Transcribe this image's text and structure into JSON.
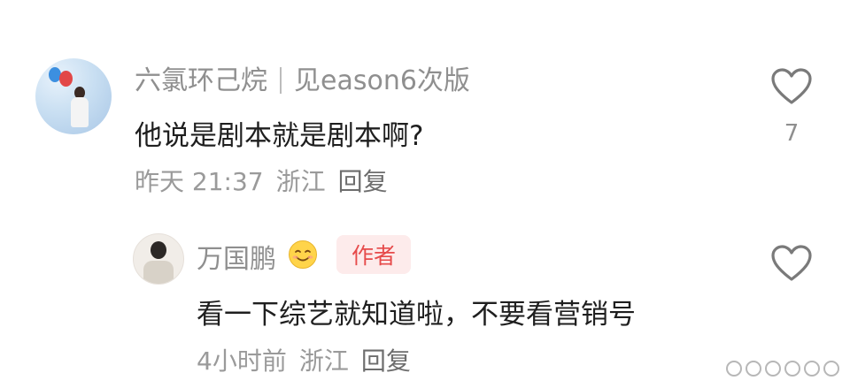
{
  "comment": {
    "username": "六氯环己烷",
    "user_tag": "见eason6次版",
    "text": "他说是剧本就是剧本啊?",
    "time": "昨天 21:37",
    "location": "浙江",
    "reply_label": "回复",
    "like_icon": "heart-outline-icon",
    "like_count": "7"
  },
  "reply": {
    "username": "万国鹏",
    "emoji": "smiling-face-icon",
    "author_badge": "作者",
    "text": "看一下综艺就知道啦，不要看营销号",
    "time": "4小时前",
    "location": "浙江",
    "reply_label": "回复",
    "like_icon": "heart-outline-icon"
  },
  "colors": {
    "author_badge_bg": "#fdebeb",
    "author_badge_text": "#e64a4a",
    "username": "#8f8f8f",
    "body_text": "#1f1f1f"
  }
}
